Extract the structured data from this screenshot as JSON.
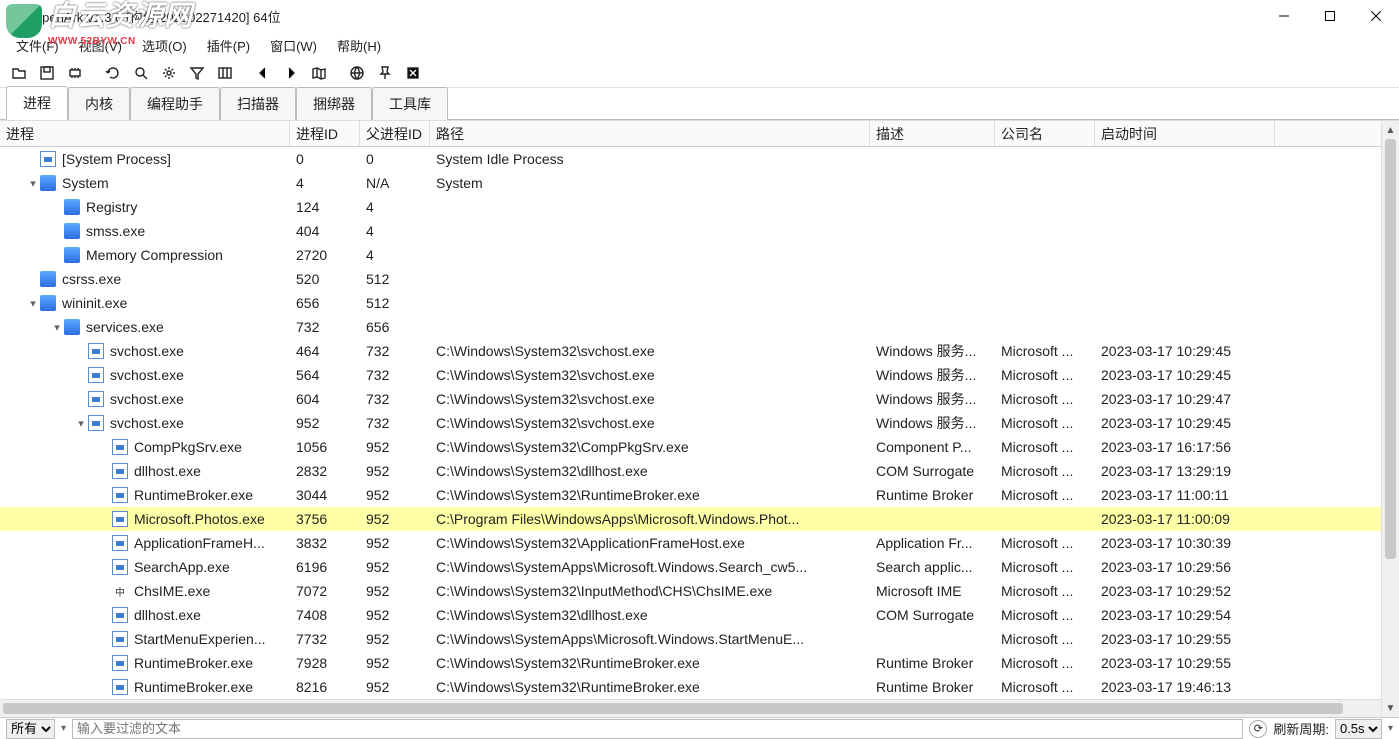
{
  "watermark": {
    "main": "白云资源网",
    "sub": "WWW.52BYW.CN"
  },
  "title": "OpenArk v1.3.0 [构建:202302271420]  64位",
  "menu": [
    "文件(F)",
    "视图(V)",
    "选项(O)",
    "插件(P)",
    "窗口(W)",
    "帮助(H)"
  ],
  "tabs": [
    "进程",
    "内核",
    "编程助手",
    "扫描器",
    "捆绑器",
    "工具库"
  ],
  "columns": [
    "进程",
    "进程ID",
    "父进程ID",
    "路径",
    "描述",
    "公司名",
    "启动时间"
  ],
  "rows": [
    {
      "indent": 0,
      "chev": "",
      "icon": "app",
      "name": "[System Process]",
      "pid": "0",
      "ppid": "0",
      "path": "System Idle Process",
      "desc": "",
      "comp": "",
      "time": "",
      "sel": false
    },
    {
      "indent": 0,
      "chev": "v",
      "icon": "blue",
      "name": "System",
      "pid": "4",
      "ppid": "N/A",
      "path": "System",
      "desc": "",
      "comp": "",
      "time": "",
      "sel": false
    },
    {
      "indent": 1,
      "chev": "",
      "icon": "blue",
      "name": "Registry",
      "pid": "124",
      "ppid": "4",
      "path": "",
      "desc": "",
      "comp": "",
      "time": "",
      "sel": false
    },
    {
      "indent": 1,
      "chev": "",
      "icon": "blue",
      "name": "smss.exe",
      "pid": "404",
      "ppid": "4",
      "path": "",
      "desc": "",
      "comp": "",
      "time": "",
      "sel": false
    },
    {
      "indent": 1,
      "chev": "",
      "icon": "blue",
      "name": "Memory Compression",
      "pid": "2720",
      "ppid": "4",
      "path": "",
      "desc": "",
      "comp": "",
      "time": "",
      "sel": false
    },
    {
      "indent": 0,
      "chev": "",
      "icon": "blue",
      "name": "csrss.exe",
      "pid": "520",
      "ppid": "512",
      "path": "",
      "desc": "",
      "comp": "",
      "time": "",
      "sel": false
    },
    {
      "indent": 0,
      "chev": "v",
      "icon": "blue",
      "name": "wininit.exe",
      "pid": "656",
      "ppid": "512",
      "path": "",
      "desc": "",
      "comp": "",
      "time": "",
      "sel": false
    },
    {
      "indent": 1,
      "chev": "v",
      "icon": "blue",
      "name": "services.exe",
      "pid": "732",
      "ppid": "656",
      "path": "",
      "desc": "",
      "comp": "",
      "time": "",
      "sel": false
    },
    {
      "indent": 2,
      "chev": "",
      "icon": "app",
      "name": "svchost.exe",
      "pid": "464",
      "ppid": "732",
      "path": "C:\\Windows\\System32\\svchost.exe",
      "desc": "Windows 服务...",
      "comp": "Microsoft ...",
      "time": "2023-03-17 10:29:45",
      "sel": false
    },
    {
      "indent": 2,
      "chev": "",
      "icon": "app",
      "name": "svchost.exe",
      "pid": "564",
      "ppid": "732",
      "path": "C:\\Windows\\System32\\svchost.exe",
      "desc": "Windows 服务...",
      "comp": "Microsoft ...",
      "time": "2023-03-17 10:29:45",
      "sel": false
    },
    {
      "indent": 2,
      "chev": "",
      "icon": "app",
      "name": "svchost.exe",
      "pid": "604",
      "ppid": "732",
      "path": "C:\\Windows\\System32\\svchost.exe",
      "desc": "Windows 服务...",
      "comp": "Microsoft ...",
      "time": "2023-03-17 10:29:47",
      "sel": false
    },
    {
      "indent": 2,
      "chev": "v",
      "icon": "app",
      "name": "svchost.exe",
      "pid": "952",
      "ppid": "732",
      "path": "C:\\Windows\\System32\\svchost.exe",
      "desc": "Windows 服务...",
      "comp": "Microsoft ...",
      "time": "2023-03-17 10:29:45",
      "sel": false
    },
    {
      "indent": 3,
      "chev": "",
      "icon": "app",
      "name": "CompPkgSrv.exe",
      "pid": "1056",
      "ppid": "952",
      "path": "C:\\Windows\\System32\\CompPkgSrv.exe",
      "desc": "Component P...",
      "comp": "Microsoft ...",
      "time": "2023-03-17 16:17:56",
      "sel": false
    },
    {
      "indent": 3,
      "chev": "",
      "icon": "app",
      "name": "dllhost.exe",
      "pid": "2832",
      "ppid": "952",
      "path": "C:\\Windows\\System32\\dllhost.exe",
      "desc": "COM Surrogate",
      "comp": "Microsoft ...",
      "time": "2023-03-17 13:29:19",
      "sel": false
    },
    {
      "indent": 3,
      "chev": "",
      "icon": "app",
      "name": "RuntimeBroker.exe",
      "pid": "3044",
      "ppid": "952",
      "path": "C:\\Windows\\System32\\RuntimeBroker.exe",
      "desc": "Runtime Broker",
      "comp": "Microsoft ...",
      "time": "2023-03-17 11:00:11",
      "sel": false
    },
    {
      "indent": 3,
      "chev": "",
      "icon": "app",
      "name": "Microsoft.Photos.exe",
      "pid": "3756",
      "ppid": "952",
      "path": "C:\\Program Files\\WindowsApps\\Microsoft.Windows.Phot...",
      "desc": "",
      "comp": "",
      "time": "2023-03-17 11:00:09",
      "sel": true
    },
    {
      "indent": 3,
      "chev": "",
      "icon": "app",
      "name": "ApplicationFrameH...",
      "pid": "3832",
      "ppid": "952",
      "path": "C:\\Windows\\System32\\ApplicationFrameHost.exe",
      "desc": "Application Fr...",
      "comp": "Microsoft ...",
      "time": "2023-03-17 10:30:39",
      "sel": false
    },
    {
      "indent": 3,
      "chev": "",
      "icon": "app",
      "name": "SearchApp.exe",
      "pid": "6196",
      "ppid": "952",
      "path": "C:\\Windows\\SystemApps\\Microsoft.Windows.Search_cw5...",
      "desc": "Search applic...",
      "comp": "Microsoft ...",
      "time": "2023-03-17 10:29:56",
      "sel": false
    },
    {
      "indent": 3,
      "chev": "",
      "icon": "ime",
      "name": "ChsIME.exe",
      "pid": "7072",
      "ppid": "952",
      "path": "C:\\Windows\\System32\\InputMethod\\CHS\\ChsIME.exe",
      "desc": "Microsoft IME",
      "comp": "Microsoft ...",
      "time": "2023-03-17 10:29:52",
      "sel": false
    },
    {
      "indent": 3,
      "chev": "",
      "icon": "app",
      "name": "dllhost.exe",
      "pid": "7408",
      "ppid": "952",
      "path": "C:\\Windows\\System32\\dllhost.exe",
      "desc": "COM Surrogate",
      "comp": "Microsoft ...",
      "time": "2023-03-17 10:29:54",
      "sel": false
    },
    {
      "indent": 3,
      "chev": "",
      "icon": "app",
      "name": "StartMenuExperien...",
      "pid": "7732",
      "ppid": "952",
      "path": "C:\\Windows\\SystemApps\\Microsoft.Windows.StartMenuE...",
      "desc": "",
      "comp": "Microsoft ...",
      "time": "2023-03-17 10:29:55",
      "sel": false
    },
    {
      "indent": 3,
      "chev": "",
      "icon": "app",
      "name": "RuntimeBroker.exe",
      "pid": "7928",
      "ppid": "952",
      "path": "C:\\Windows\\System32\\RuntimeBroker.exe",
      "desc": "Runtime Broker",
      "comp": "Microsoft ...",
      "time": "2023-03-17 10:29:55",
      "sel": false
    },
    {
      "indent": 3,
      "chev": "",
      "icon": "app",
      "name": "RuntimeBroker.exe",
      "pid": "8216",
      "ppid": "952",
      "path": "C:\\Windows\\System32\\RuntimeBroker.exe",
      "desc": "Runtime Broker",
      "comp": "Microsoft ...",
      "time": "2023-03-17 19:46:13",
      "sel": false
    }
  ],
  "status": {
    "filter": "所有",
    "placeholder": "输入要过滤的文本",
    "refresh_label": "刷新周期:",
    "refresh_value": "0.5s"
  }
}
